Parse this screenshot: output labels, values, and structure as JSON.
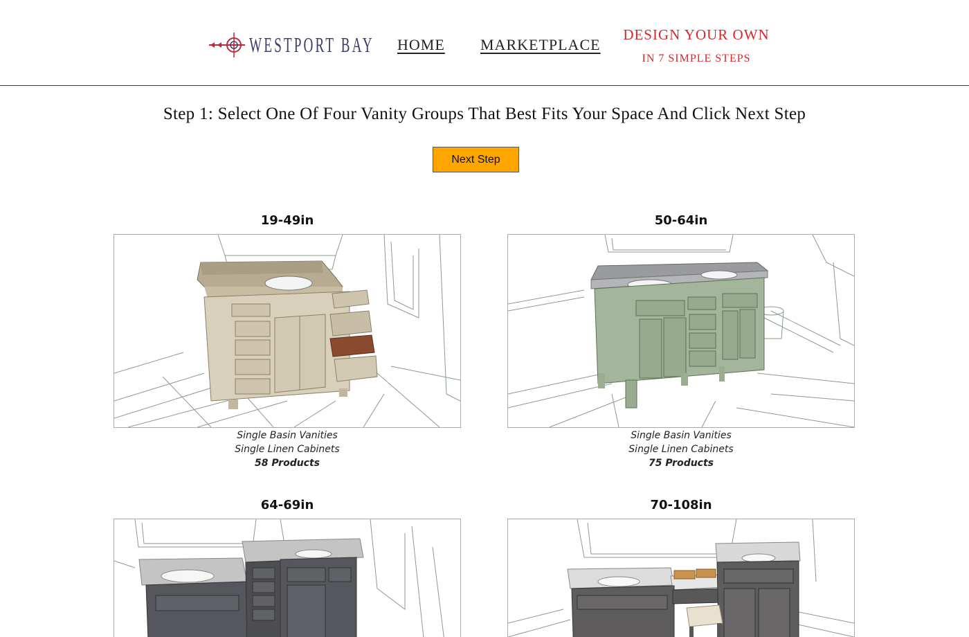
{
  "header": {
    "logo_text": "WESTPORT BAY",
    "nav": [
      {
        "label": "HOME"
      },
      {
        "label": "MARKETPLACE"
      }
    ],
    "design": {
      "title": "DESIGN YOUR OWN",
      "subtitle": "IN 7 SIMPLE STEPS"
    }
  },
  "step": {
    "title": "Step 1: Select One Of Four Vanity Groups That Best Fits Your Space And Click Next Step",
    "next_button": "Next Step"
  },
  "groups": [
    {
      "size": "19-49in",
      "line1": "Single Basin Vanities",
      "line2": "Single Linen Cabinets",
      "count": "58 Products",
      "cabinet_color": "#d9d0bb"
    },
    {
      "size": "50-64in",
      "line1": "Single Basin Vanities",
      "line2": "Single Linen Cabinets",
      "count": "75 Products",
      "cabinet_color": "#a3b59a"
    },
    {
      "size": "64-69in",
      "cabinet_color": "#55575c"
    },
    {
      "size": "70-108in",
      "cabinet_color": "#5f5c5d"
    }
  ],
  "colors": {
    "accent_red": "#d8262c",
    "button_orange": "#ffa500",
    "logo_navy": "#3b3d6b"
  }
}
